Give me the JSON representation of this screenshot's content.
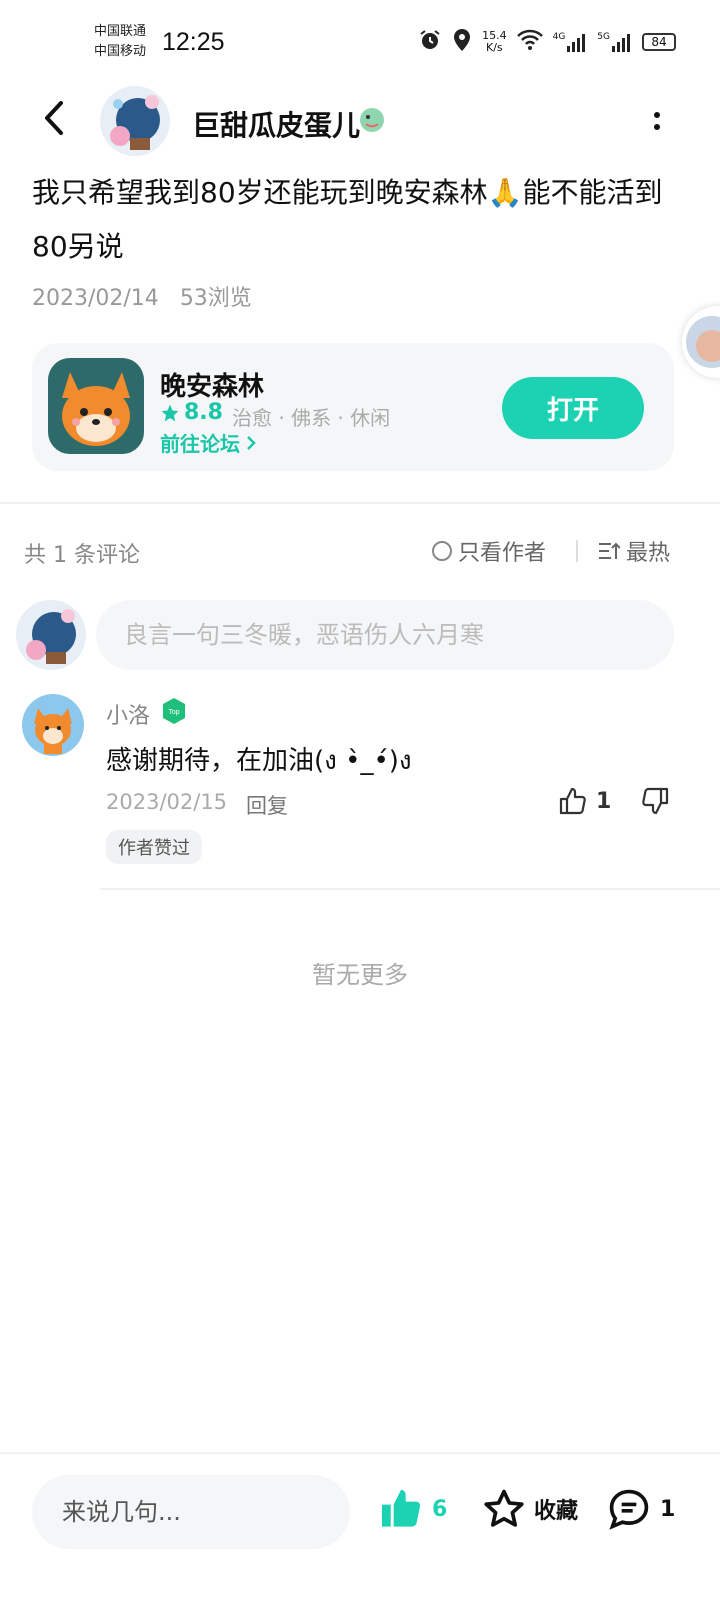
{
  "status_bar": {
    "carrier1": "中国联通",
    "carrier2": "中国移动",
    "time": "12:25",
    "speed_value": "15.4",
    "speed_unit": "K/s",
    "net1": "4G",
    "net2": "5G",
    "battery": "84",
    "icons": [
      "alarm-icon",
      "location-icon",
      "wifi-icon",
      "signal-icon",
      "battery-icon"
    ]
  },
  "header": {
    "username": "巨甜瓜皮蛋儿",
    "icons": [
      "back-icon",
      "dragon-badge-icon",
      "more-icon"
    ]
  },
  "post": {
    "text": "我只希望我到80岁还能玩到晚安森林🙏能不能活到80另说",
    "date": "2023/02/14",
    "views": "53浏览"
  },
  "app_card": {
    "name": "晚安森林",
    "rating": "8.8",
    "tags": "治愈 · 佛系 · 休闲",
    "forum_link": "前往论坛",
    "open_label": "打开"
  },
  "comments_header": {
    "count_label": "共 1 条评论",
    "author_only": "只看作者",
    "sort_label": "最热"
  },
  "comment_input": {
    "placeholder": "良言一句三冬暖，恶语伤人六月寒"
  },
  "comments": [
    {
      "name": "小洛",
      "text": "感谢期待，在加油(ง •̀_•́)ง",
      "date": "2023/02/15",
      "reply_label": "回复",
      "likes": "1",
      "author_liked": "作者赞过"
    }
  ],
  "no_more": "暂无更多",
  "bottom_bar": {
    "placeholder": "来说几句...",
    "likes": "6",
    "favorite_label": "收藏",
    "comments": "1"
  },
  "colors": {
    "accent": "#1dd1b3",
    "text_primary": "#111111",
    "text_secondary": "#999999",
    "card_bg": "#f4f6f8"
  }
}
